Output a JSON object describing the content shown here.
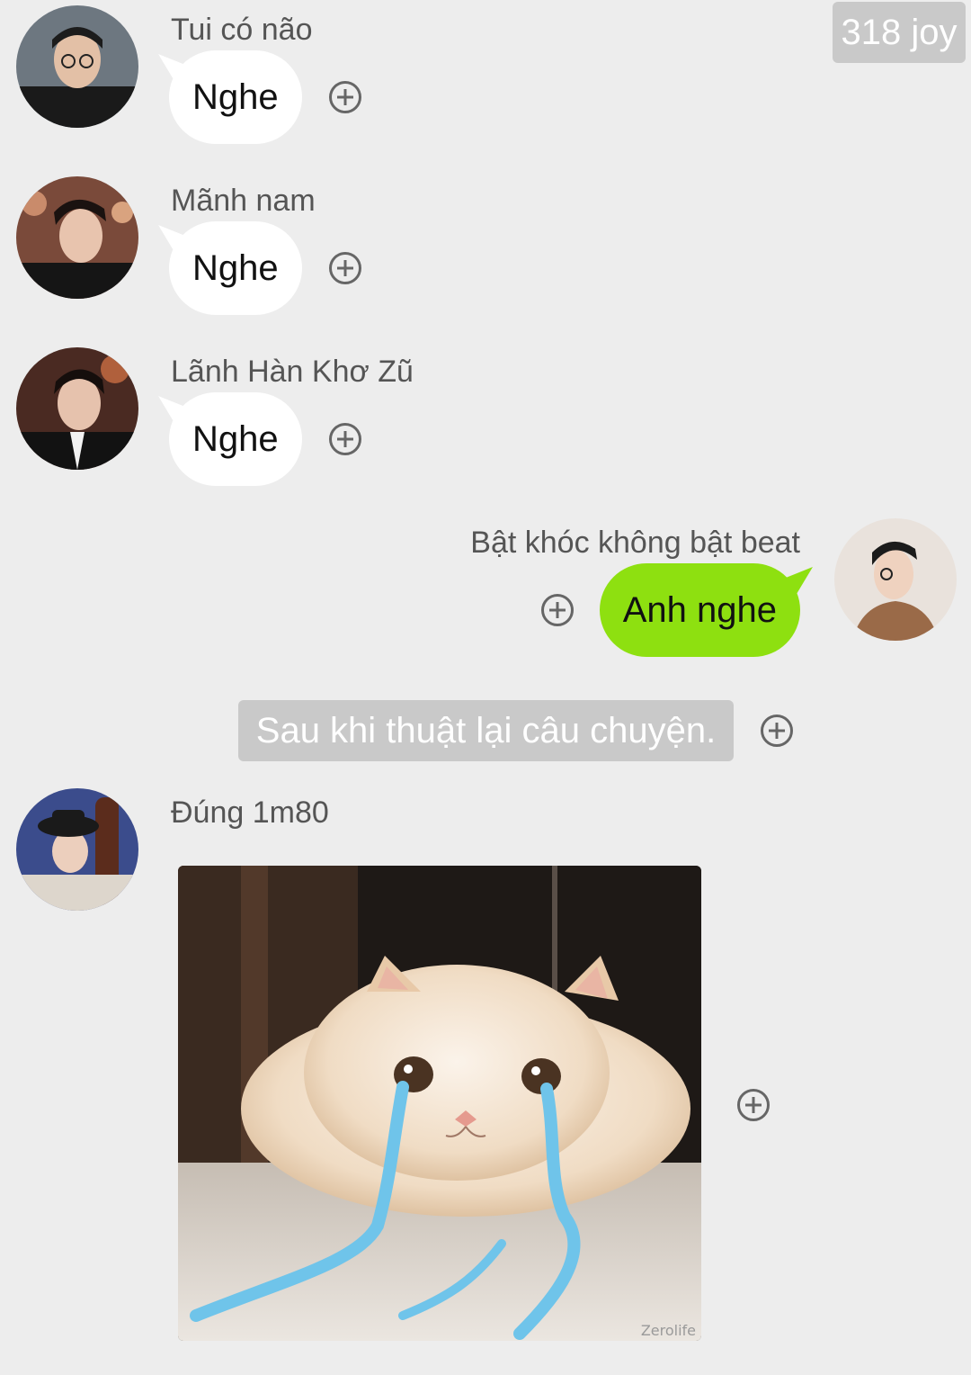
{
  "header": {
    "badge": "318 joy"
  },
  "messages": [
    {
      "sender": "Tui có não",
      "text": "Nghe"
    },
    {
      "sender": "Mãnh nam",
      "text": "Nghe"
    },
    {
      "sender": "Lãnh Hàn Khơ Zũ",
      "text": "Nghe"
    },
    {
      "sender": "Bật khóc không bật beat",
      "text": "Anh nghe"
    },
    {
      "system": "Sau khi thuật lại câu chuyện."
    },
    {
      "sender": "Đúng 1m80",
      "image": "crying-cat-sticker"
    }
  ],
  "image_watermark": "Zerolife",
  "icons": {
    "add": "plus-circle-icon"
  },
  "colors": {
    "background": "#ededed",
    "own_bubble": "#8ee010",
    "other_bubble": "#ffffff",
    "system_badge": "#c9c9c9"
  }
}
